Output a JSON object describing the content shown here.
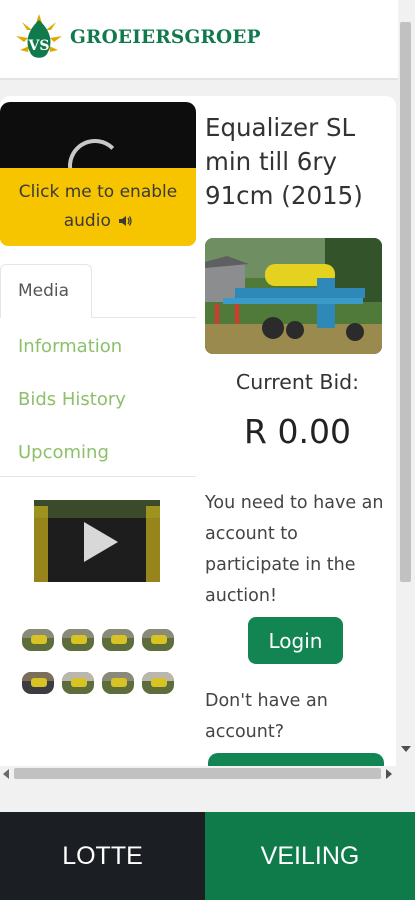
{
  "header": {
    "brand": "GROEIERSGROEP",
    "logo_letters": "VS"
  },
  "sidebar": {
    "audio_button": "Click me to enable audio",
    "audio_icon": "speaker-icon",
    "tabs": [
      {
        "label": "Media",
        "active": true
      },
      {
        "label": "Information",
        "active": false
      },
      {
        "label": "Bids History",
        "active": false
      },
      {
        "label": "Upcoming",
        "active": false
      }
    ]
  },
  "lot": {
    "title": "Equalizer SL min till 6ry 91cm (2015)",
    "current_bid_label": "Current Bid:",
    "current_bid": "R 0.00",
    "account_notice": "You need to have an account to participate in the auction!",
    "login_label": "Login",
    "no_account": "Don't have an account?"
  },
  "bottom_nav": {
    "left": "LOTTE",
    "right": "VEILING"
  },
  "colors": {
    "brand_green": "#138552",
    "tab_link_green": "#8cc06a",
    "audio_yellow": "#f7c400",
    "nav_dark": "#1b1e22"
  }
}
